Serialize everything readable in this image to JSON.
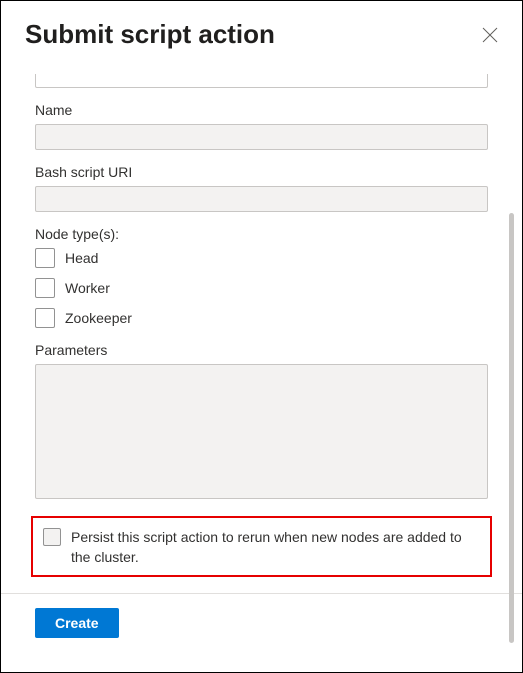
{
  "header": {
    "title": "Submit script action"
  },
  "form": {
    "name_label": "Name",
    "name_value": "",
    "uri_label": "Bash script URI",
    "uri_value": "",
    "nodetypes_label": "Node type(s):",
    "nodetypes": [
      {
        "label": "Head"
      },
      {
        "label": "Worker"
      },
      {
        "label": "Zookeeper"
      }
    ],
    "parameters_label": "Parameters",
    "parameters_value": "",
    "persist_label": "Persist this script action to rerun when new nodes are added to the cluster."
  },
  "footer": {
    "create_label": "Create"
  }
}
